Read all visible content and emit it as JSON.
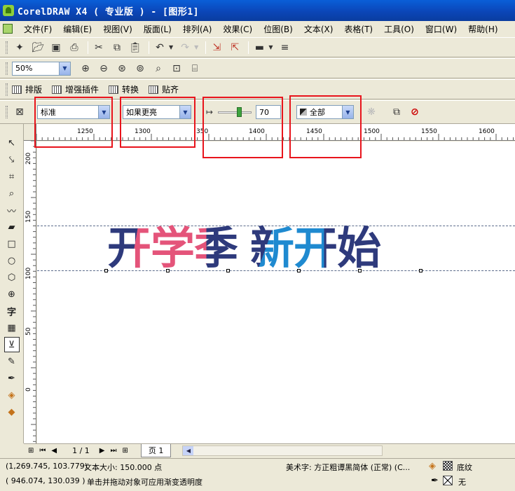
{
  "window": {
    "title": "CorelDRAW X4 ( 专业版 ) - [图形1]"
  },
  "menu": [
    "文件(F)",
    "编辑(E)",
    "视图(V)",
    "版面(L)",
    "排列(A)",
    "效果(C)",
    "位图(B)",
    "文本(X)",
    "表格(T)",
    "工具(O)",
    "窗口(W)",
    "帮助(H)"
  ],
  "zoom": {
    "value": "50%"
  },
  "plugins": {
    "items": [
      "排版",
      "增强插件",
      "转换",
      "贴齐"
    ]
  },
  "property_bar": {
    "transparency_type": "标准",
    "merge_mode": "如果更亮",
    "opacity": "70",
    "apply_to": "全部"
  },
  "ruler": {
    "h_labels": [
      "1250",
      "1300",
      "350",
      "1400",
      "1450",
      "1500",
      "1550",
      "1600"
    ],
    "v_labels": [
      "200",
      "150",
      "100",
      "50",
      "0"
    ]
  },
  "canvas": {
    "headline": [
      "开",
      "学",
      "季",
      " ",
      "新",
      "开",
      "始"
    ]
  },
  "page_nav": {
    "page_counter": "1 / 1",
    "page_tab": "页 1"
  },
  "status": {
    "coords_1": "(1,269.745, 103.779)",
    "text_size": "文本大小: 150.000 点",
    "font_info": "美术字: 方正粗谭黑简体 (正常) (C...",
    "coords_2": "( 946.074, 130.039 )",
    "hint": "单击并拖动对象可应用渐变透明度",
    "fill_label": "底纹",
    "outline_label": "无"
  },
  "colors": {
    "pink": "#e4547a",
    "navy": "#2e3a7c",
    "blue": "#1f8ad0",
    "accent_red": "#e8141c"
  }
}
